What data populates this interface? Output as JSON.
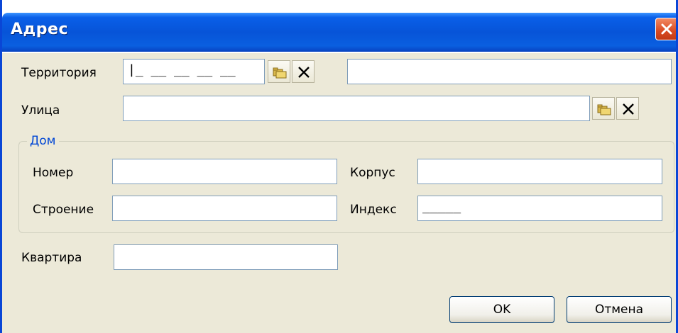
{
  "window": {
    "title": "Адрес"
  },
  "territory": {
    "label": "Территория",
    "code_mask": "|_ __ __ __ __",
    "name_value": ""
  },
  "street": {
    "label": "Улица",
    "value": ""
  },
  "house": {
    "group_label": "Дом",
    "number_label": "Номер",
    "number_value": "",
    "building_label": "Корпус",
    "building_value": "",
    "structure_label": "Строение",
    "structure_value": "",
    "index_label": "Индекс",
    "index_mask": "_____"
  },
  "apartment": {
    "label": "Квартира",
    "value": ""
  },
  "buttons": {
    "ok": "OK",
    "cancel": "Отмена"
  },
  "icons": {
    "lookup": "folders-lookup-icon",
    "clear": "clear-x-icon",
    "close": "close-icon"
  },
  "colors": {
    "title_bar": "#0754d8",
    "close_button": "#d94a22",
    "group_label": "#0046d5",
    "field_border": "#7f9db9",
    "window_bg": "#ece9d8"
  }
}
